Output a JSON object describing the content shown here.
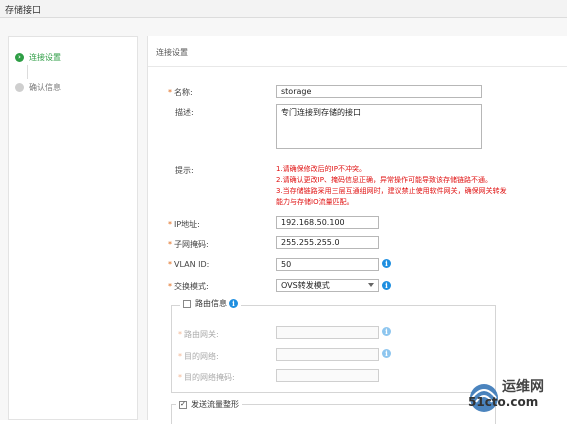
{
  "window": {
    "title": "存储接口"
  },
  "steps": [
    {
      "label": "连接设置",
      "state": "active"
    },
    {
      "label": "确认信息",
      "state": "inactive"
    }
  ],
  "main": {
    "section_title": "连接设置",
    "name": {
      "label": "名称:",
      "value": "storage"
    },
    "desc": {
      "label": "描述:",
      "value": "专门连接到存储的接口"
    },
    "tips": {
      "label": "提示:",
      "lines": [
        "1.请确保修改后的IP不冲突。",
        "2.请确认更改IP、掩码信息正确，异常操作可能导致该存储链路不通。",
        "3.当存储链路采用三层互通组网时，建议禁止使用软件网关，确保网关转发",
        "能力与存储IO流量匹配。"
      ]
    },
    "ip": {
      "label": "IP地址:",
      "value": "192.168.50.100"
    },
    "mask": {
      "label": "子网掩码:",
      "value": "255.255.255.0"
    },
    "vlan": {
      "label": "VLAN ID:",
      "value": "50"
    },
    "switch_mode": {
      "label": "交换模式:",
      "value": "OVS转发模式"
    },
    "route": {
      "legend": "路由信息",
      "checked": false,
      "gateway_label": "路由网关:",
      "target_net_label": "目的网络:",
      "target_mask_label": "目的网络掩码:"
    },
    "traffic": {
      "legend": "发送流量整形",
      "checked": true
    }
  },
  "watermark": {
    "text": "运维网",
    "sub": "51cto.com"
  },
  "colors": {
    "accent_green": "#2e9e45",
    "warning_red": "#e01010",
    "info_blue": "#1f8fe0",
    "required_orange": "#e06a1a"
  }
}
